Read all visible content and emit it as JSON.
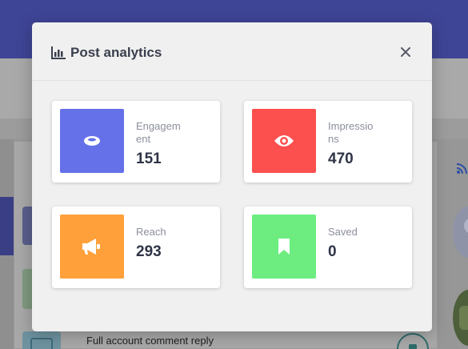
{
  "background": {
    "row_text": "Full account comment reply"
  },
  "modal": {
    "title": "Post analytics",
    "title_icon": "bar-chart-icon",
    "close_icon": "close-icon"
  },
  "stats": {
    "engagement": {
      "label": "Engagement",
      "value": "151",
      "icon": "ring-icon",
      "color": "#6571e8"
    },
    "impressions": {
      "label": "Impressions",
      "value": "470",
      "icon": "eye-icon",
      "color": "#fb504e"
    },
    "reach": {
      "label": "Reach",
      "value": "293",
      "icon": "megaphone-icon",
      "color": "#ffa03a"
    },
    "saved": {
      "label": "Saved",
      "value": "0",
      "icon": "bookmark-icon",
      "color": "#6ded7f"
    }
  }
}
